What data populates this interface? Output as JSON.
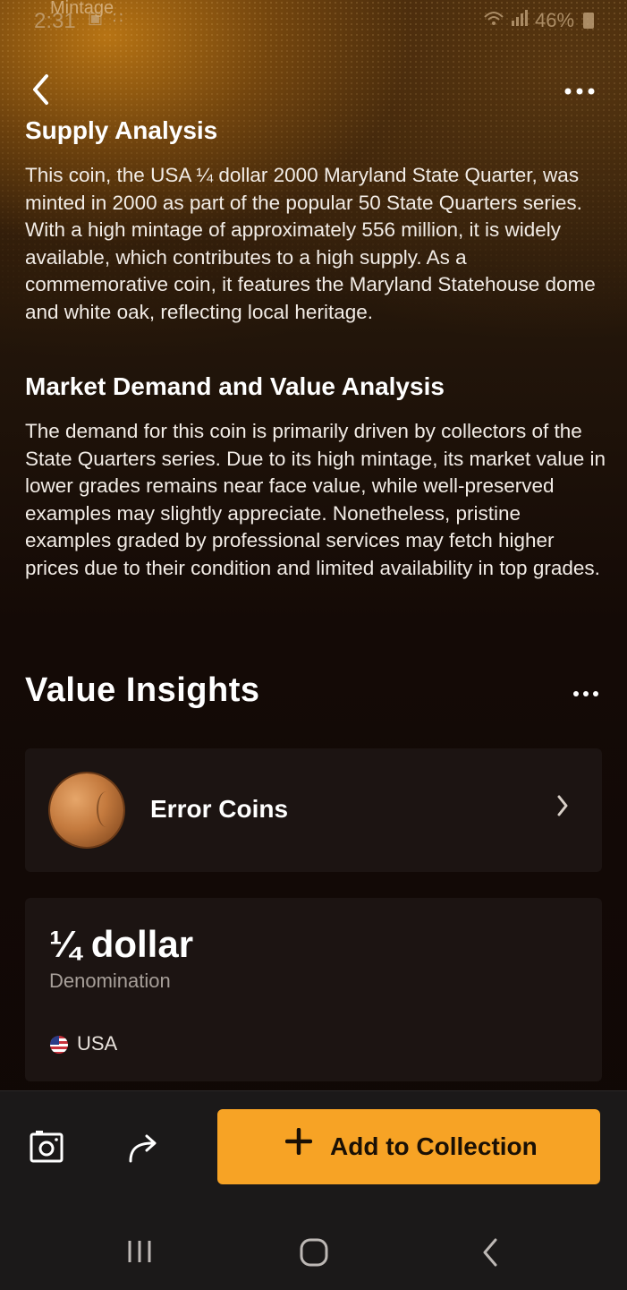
{
  "status_bar": {
    "time": "2:31",
    "app_name": "Mintage",
    "notification_icons": "▣ ∷",
    "battery": "46%"
  },
  "supply": {
    "title": "Supply Analysis",
    "body": "This coin, the USA ¼ dollar 2000 Maryland State Quarter, was minted in 2000 as part of the popular 50 State Quarters series. With a high mintage of approximately 556 million, it is widely available, which contributes to a high supply. As a commemorative coin, it features the Maryland Statehouse dome and white oak, reflecting local heritage."
  },
  "demand": {
    "title": "Market Demand and Value Analysis",
    "body": "The demand for this coin is primarily driven by collectors of the State Quarters series. Due to its high mintage, its market value in lower grades remains near face value, while well-preserved examples may slightly appreciate. Nonetheless, pristine examples graded by professional services may fetch higher prices due to their condition and limited availability in top grades."
  },
  "value_insights": {
    "title": "Value Insights",
    "error_coins_label": "Error Coins"
  },
  "denomination": {
    "value": "¼ dollar",
    "label": "Denomination",
    "country": "USA"
  },
  "actions": {
    "add_label": "Add to Collection"
  },
  "icons": [
    "back-icon",
    "more-icon",
    "coin-image-icon",
    "chevron-right-icon",
    "flag-usa-icon",
    "camera-icon",
    "share-icon",
    "plus-icon",
    "recents-icon",
    "home-icon",
    "nav-back-icon"
  ]
}
